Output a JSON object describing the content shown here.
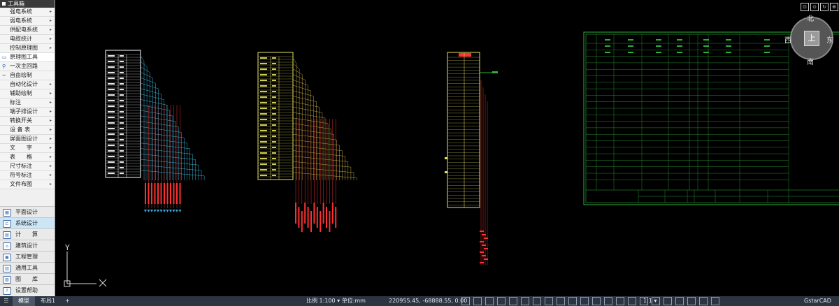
{
  "toolbox": {
    "title": "工具箱",
    "menu": [
      {
        "label": "强电系统",
        "arrow": "▸"
      },
      {
        "label": "弱电系统",
        "arrow": "▸"
      },
      {
        "label": "供配电系统",
        "arrow": "▸"
      },
      {
        "label": "电缆统计",
        "arrow": "▸"
      },
      {
        "label": "控制原理图",
        "arrow": "▸"
      },
      {
        "label": "原理图工具",
        "arrow": ""
      },
      {
        "label": "一次主回路",
        "arrow": ""
      },
      {
        "label": "自由绘制",
        "arrow": ""
      },
      {
        "label": "自动化设计",
        "arrow": "▸"
      },
      {
        "label": "辅助绘制",
        "arrow": "▸"
      },
      {
        "label": "标注",
        "arrow": "▸"
      },
      {
        "label": "端子排设计",
        "arrow": "▸"
      },
      {
        "label": "转换开关",
        "arrow": "▸"
      },
      {
        "label": "设 备 表",
        "arrow": "▸"
      },
      {
        "label": "屏面图设计",
        "arrow": "▸"
      },
      {
        "label": "文　　字",
        "arrow": "▸"
      },
      {
        "label": "表　　格",
        "arrow": "▸"
      },
      {
        "label": "尺寸标注",
        "arrow": "▸"
      },
      {
        "label": "符号标注",
        "arrow": "▸"
      },
      {
        "label": "文件布图",
        "arrow": "▸"
      }
    ],
    "bottom": [
      {
        "label": "平面设计",
        "icon": "▦"
      },
      {
        "label": "系统设计",
        "icon": "⊏"
      },
      {
        "label": "计　　算",
        "icon": "▤"
      },
      {
        "label": "建筑设计",
        "icon": "⌂"
      },
      {
        "label": "工程管理",
        "icon": "▣"
      },
      {
        "label": "通用工具",
        "icon": "▥"
      },
      {
        "label": "图　　库",
        "icon": "▧"
      },
      {
        "label": "设置帮助",
        "icon": "?"
      }
    ]
  },
  "viewcube": {
    "north": "北",
    "south": "南",
    "east": "东",
    "west": "西",
    "face": "上"
  },
  "ucs": {
    "y_label": "Y"
  },
  "statusbar": {
    "tabs": [
      "模型",
      "布局1"
    ],
    "add": "+",
    "scale": "比例 1:100 ▾ 单位:mm",
    "coords": "220955.45, -68888.55, 0.00",
    "ratio": "1:1 ▾",
    "brand": "GstarCAD"
  },
  "top_icons": [
    "⊡",
    "⊙",
    "↻",
    "⊕",
    "ℹ",
    "⊟"
  ]
}
